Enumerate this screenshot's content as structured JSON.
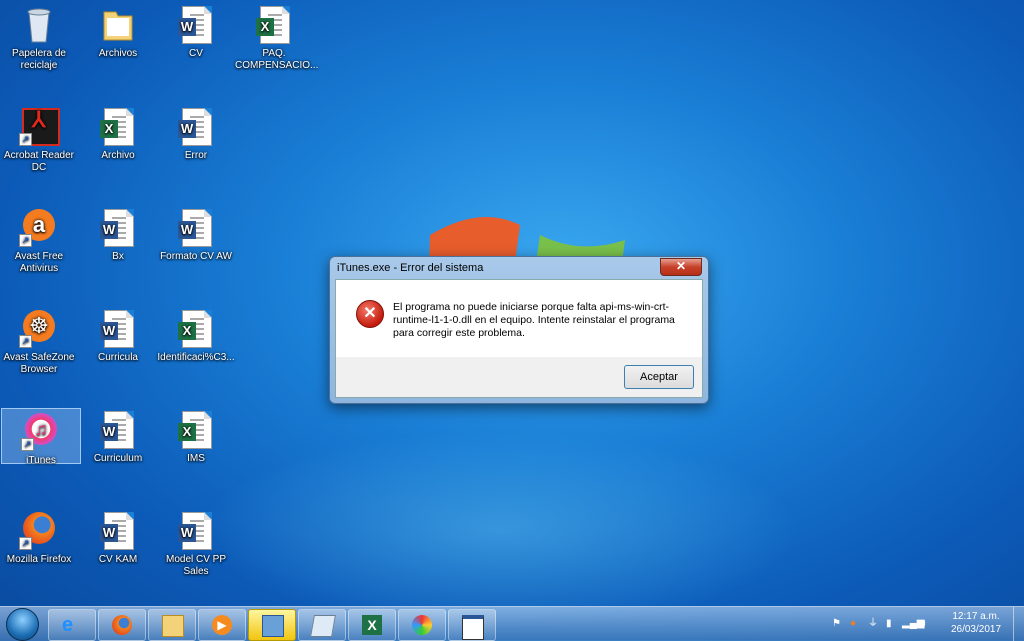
{
  "desktop": {
    "icons": [
      {
        "label": "Papelera de reciclaje",
        "icon": "recycle-bin-icon"
      },
      {
        "label": "Archivos",
        "icon": "folder-icon"
      },
      {
        "label": "CV",
        "icon": "word-doc-icon"
      },
      {
        "label": "PAQ. COMPENSACIO...",
        "icon": "excel-doc-icon"
      },
      {
        "label": "Acrobat Reader DC",
        "icon": "acrobat-icon"
      },
      {
        "label": "Archivo",
        "icon": "excel-doc-icon"
      },
      {
        "label": "Error",
        "icon": "word-doc-icon"
      },
      {
        "label": "Avast Free Antivirus",
        "icon": "avast-icon"
      },
      {
        "label": "Bx",
        "icon": "word-doc-icon"
      },
      {
        "label": "Formato CV  AW",
        "icon": "word-doc-icon"
      },
      {
        "label": "Avast SafeZone Browser",
        "icon": "safezone-icon"
      },
      {
        "label": "Curricula",
        "icon": "word-doc-icon"
      },
      {
        "label": "Identificaci%C3...",
        "icon": "excel-doc-icon"
      },
      {
        "label": "iTunes",
        "icon": "itunes-icon"
      },
      {
        "label": "Curriculum",
        "icon": "word-doc-icon"
      },
      {
        "label": "IMS",
        "icon": "excel-doc-icon"
      },
      {
        "label": "Mozilla Firefox",
        "icon": "firefox-icon"
      },
      {
        "label": "CV KAM",
        "icon": "word-doc-icon"
      },
      {
        "label": "Model CV PP Sales",
        "icon": "word-doc-icon"
      }
    ]
  },
  "dialog": {
    "title": "iTunes.exe - Error del sistema",
    "close_label": "✕",
    "message": "El programa no puede iniciarse porque falta api-ms-win-crt-runtime-l1-1-0.dll en el equipo. Intente reinstalar el programa para corregir este problema.",
    "ok_label": "Aceptar"
  },
  "taskbar": {
    "items": [
      "internet-explorer-icon",
      "firefox-icon",
      "explorer-folder-icon",
      "media-player-icon",
      "installer-icon",
      "notepad-icon",
      "excel-icon",
      "paint-icon",
      "window-icon"
    ],
    "clock_time": "12:17 a.m.",
    "clock_date": "26/03/2017"
  },
  "colors": {
    "desktop": "#1a7fd6",
    "close": "#c7412a",
    "error": "#c41b0c"
  }
}
